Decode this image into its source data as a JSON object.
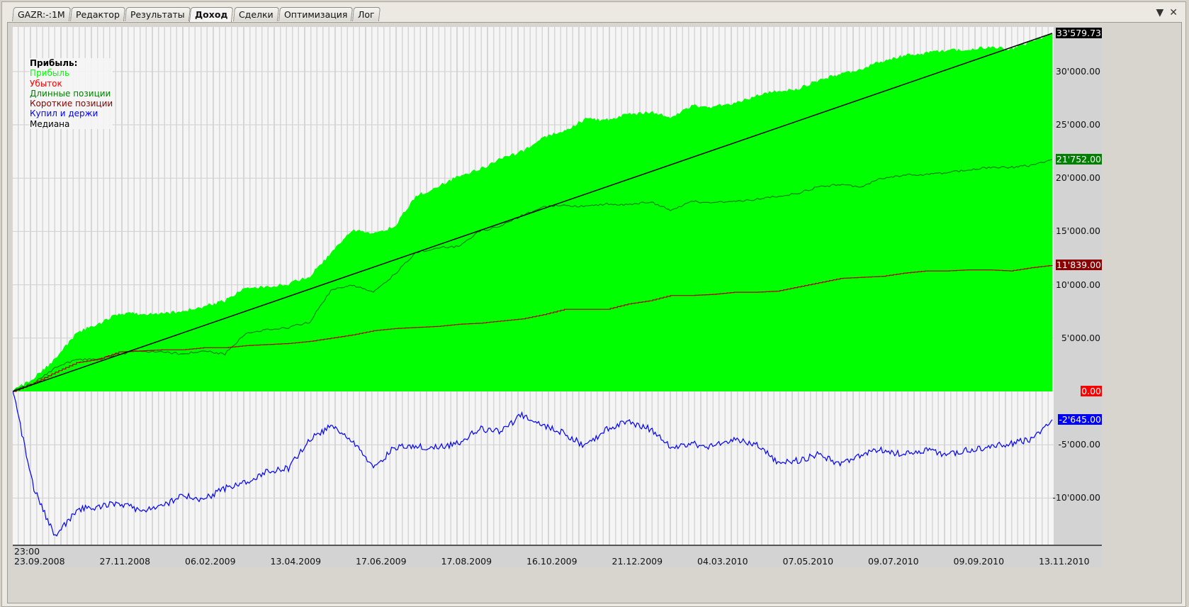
{
  "tabs": [
    {
      "label": "GAZR:-:1M"
    },
    {
      "label": "Редактор"
    },
    {
      "label": "Результаты"
    },
    {
      "label": "Доход",
      "active": true
    },
    {
      "label": "Сделки"
    },
    {
      "label": "Оптимизация"
    },
    {
      "label": "Лог"
    }
  ],
  "controls": {
    "menu_icon": "▼",
    "close_icon": "✕"
  },
  "legend": {
    "title": "Прибыль:",
    "items": [
      {
        "label": "Прибыль",
        "color": "#00ff00"
      },
      {
        "label": "Убыток",
        "color": "#ff0000"
      },
      {
        "label": "Длинные позиции",
        "color": "#008000"
      },
      {
        "label": "Короткие позиции",
        "color": "#8b0000"
      },
      {
        "label": "Купил и держи",
        "color": "#0000ff"
      },
      {
        "label": "Медиана",
        "color": "#000000"
      }
    ]
  },
  "chart_data": {
    "type": "area",
    "x_start_time": "23:00",
    "x_tick_labels": [
      "23.09.2008",
      "27.11.2008",
      "06.02.2009",
      "13.04.2009",
      "17.06.2009",
      "17.08.2009",
      "16.10.2009",
      "21.12.2009",
      "04.03.2010",
      "07.05.2010",
      "09.07.2010",
      "09.09.2010",
      "13.11.2010"
    ],
    "y_ticks": [
      {
        "value": 30000,
        "label": "30'000.00"
      },
      {
        "value": 25000,
        "label": "25'000.00"
      },
      {
        "value": 20000,
        "label": "20'000.00"
      },
      {
        "value": 15000,
        "label": "15'000.00"
      },
      {
        "value": 10000,
        "label": "10'000.00"
      },
      {
        "value": 5000,
        "label": "5'000.00"
      },
      {
        "value": -5000,
        "label": "-5'000.00"
      },
      {
        "value": -10000,
        "label": "-10'000.00"
      }
    ],
    "ylim": [
      -14500,
      34200
    ],
    "last_values": [
      {
        "series": "profit",
        "label": "33'579.73",
        "value": 33579.73,
        "bg": "#000000",
        "fg": "#ffffff"
      },
      {
        "series": "long",
        "label": "21'752.00",
        "value": 21752,
        "bg": "#008000",
        "fg": "#ffffff"
      },
      {
        "series": "short",
        "label": "11'839.00",
        "value": 11839,
        "bg": "#8b0000",
        "fg": "#ffffff"
      },
      {
        "series": "loss",
        "label": "0.00",
        "value": 0,
        "bg": "#ff0000",
        "fg": "#ffffff"
      },
      {
        "series": "buyhold",
        "label": "-2'645.00",
        "value": -2645,
        "bg": "#0000ff",
        "fg": "#ffffff"
      }
    ],
    "series": [
      {
        "name": "Прибыль",
        "key": "profit",
        "color": "#00ff00",
        "style": "area",
        "values": [
          0,
          1300,
          3000,
          5500,
          6300,
          7300,
          7300,
          7300,
          7500,
          8000,
          8500,
          9800,
          9800,
          10100,
          10800,
          13000,
          15200,
          14800,
          15500,
          18300,
          19200,
          20200,
          20800,
          21800,
          22500,
          23800,
          24500,
          25500,
          25500,
          26000,
          26200,
          25700,
          26800,
          26700,
          27000,
          27700,
          28200,
          28400,
          29200,
          29800,
          30200,
          31000,
          31500,
          31700,
          32000,
          32100,
          32300,
          32100,
          32800,
          33579.73
        ]
      },
      {
        "name": "Длинные позиции",
        "key": "long",
        "color": "#008000",
        "style": "line",
        "values": [
          0,
          800,
          2200,
          3000,
          3000,
          3500,
          3800,
          3700,
          3500,
          3800,
          3500,
          5500,
          5800,
          6000,
          6500,
          9500,
          10000,
          9300,
          11000,
          13000,
          13500,
          13600,
          15000,
          15500,
          16500,
          17300,
          17500,
          17300,
          17600,
          17500,
          17800,
          17000,
          17800,
          17700,
          17800,
          18000,
          18300,
          18600,
          19200,
          19400,
          19200,
          20000,
          20300,
          20300,
          20500,
          20800,
          21000,
          21000,
          21200,
          21752
        ]
      },
      {
        "name": "Короткие позиции",
        "key": "short",
        "color": "#b00000",
        "style": "step",
        "values": [
          0,
          800,
          1800,
          2700,
          3000,
          3700,
          3800,
          3900,
          3900,
          4100,
          4100,
          4300,
          4400,
          4500,
          4700,
          5000,
          5300,
          5700,
          5900,
          6000,
          6100,
          6300,
          6400,
          6600,
          6800,
          7200,
          7700,
          7700,
          7700,
          8200,
          8500,
          9000,
          9000,
          9100,
          9300,
          9300,
          9400,
          9800,
          10200,
          10600,
          10700,
          10800,
          11100,
          11300,
          11300,
          11400,
          11400,
          11300,
          11600,
          11839
        ]
      },
      {
        "name": "Купил и держи",
        "key": "buyhold",
        "color": "#0000ff",
        "style": "line",
        "values": [
          0,
          -9100,
          -13700,
          -11100,
          -10800,
          -10500,
          -11100,
          -10800,
          -9800,
          -10100,
          -9100,
          -8500,
          -7500,
          -7200,
          -4500,
          -3200,
          -4500,
          -7200,
          -5200,
          -5200,
          -5200,
          -4900,
          -3500,
          -3800,
          -2200,
          -3200,
          -3900,
          -5200,
          -3500,
          -2800,
          -3500,
          -5200,
          -4900,
          -5200,
          -4500,
          -4900,
          -6500,
          -6500,
          -5900,
          -6800,
          -5900,
          -5500,
          -5900,
          -5500,
          -5900,
          -5500,
          -5200,
          -4900,
          -4500,
          -2645
        ]
      },
      {
        "name": "Медиана",
        "key": "median",
        "color": "#000000",
        "style": "line",
        "values": [
          0,
          33579.73
        ]
      }
    ]
  }
}
